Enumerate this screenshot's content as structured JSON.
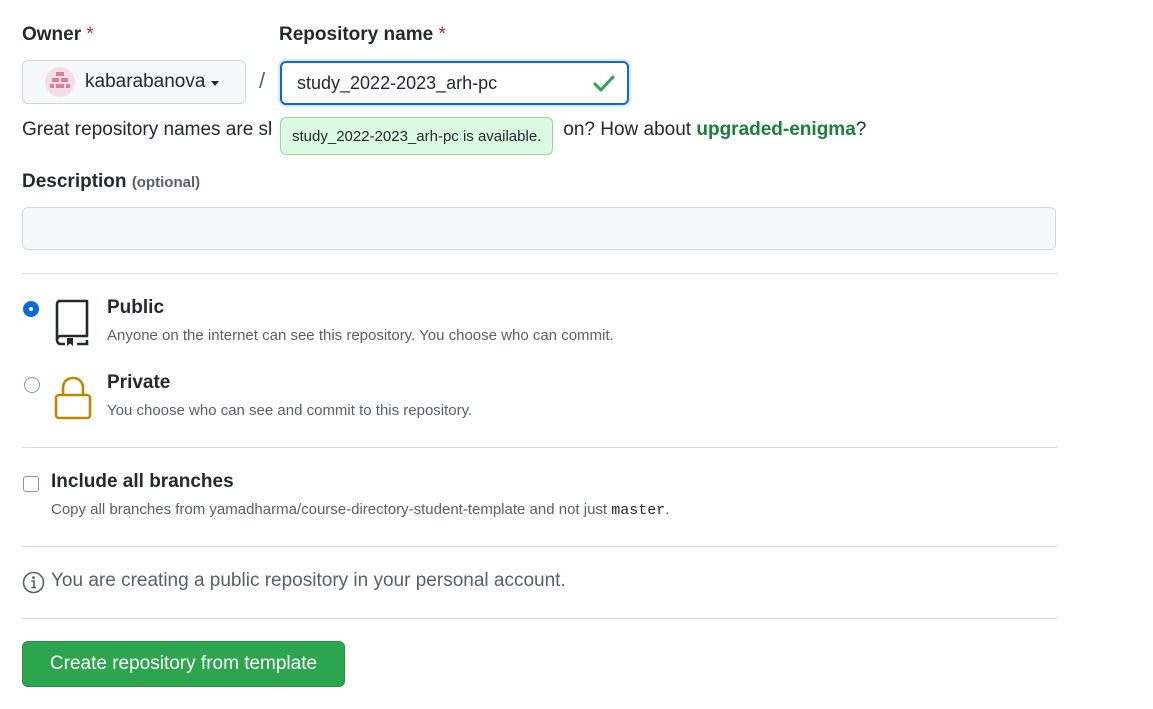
{
  "owner": {
    "label": "Owner",
    "required_mark": "*",
    "username": "kabarabanova"
  },
  "repo": {
    "label": "Repository name",
    "required_mark": "*",
    "value": "study_2022-2023_arh-pc"
  },
  "separator": "/",
  "hint": {
    "prefix": "Great repository names are sl",
    "suffix": "on? How about ",
    "suggestion": "upgraded-enigma",
    "end": "?"
  },
  "availability_tooltip": "study_2022-2023_arh-pc is available.",
  "description": {
    "label": "Description",
    "optional_label": "(optional)",
    "value": ""
  },
  "visibility": {
    "options": [
      {
        "title": "Public",
        "desc": "Anyone on the internet can see this repository. You choose who can commit.",
        "selected": true,
        "icon": "repo-icon"
      },
      {
        "title": "Private",
        "desc": "You choose who can see and commit to this repository.",
        "selected": false,
        "icon": "lock-icon"
      }
    ]
  },
  "branches": {
    "title": "Include all branches",
    "desc_prefix": "Copy all branches from yamadharma/course-directory-student-template and not just ",
    "desc_code": "master",
    "desc_suffix": ".",
    "checked": false
  },
  "info": {
    "icon": "info-icon",
    "text": "You are creating a public repository in your personal account."
  },
  "submit_label": "Create repository from template",
  "colors": {
    "primary_button": "#2da44e",
    "focus_border": "#0969da",
    "success_text": "#1a7f37",
    "tooltip_bg": "#dafbe1",
    "required": "#cf222e",
    "lock_icon": "#bf8700"
  }
}
